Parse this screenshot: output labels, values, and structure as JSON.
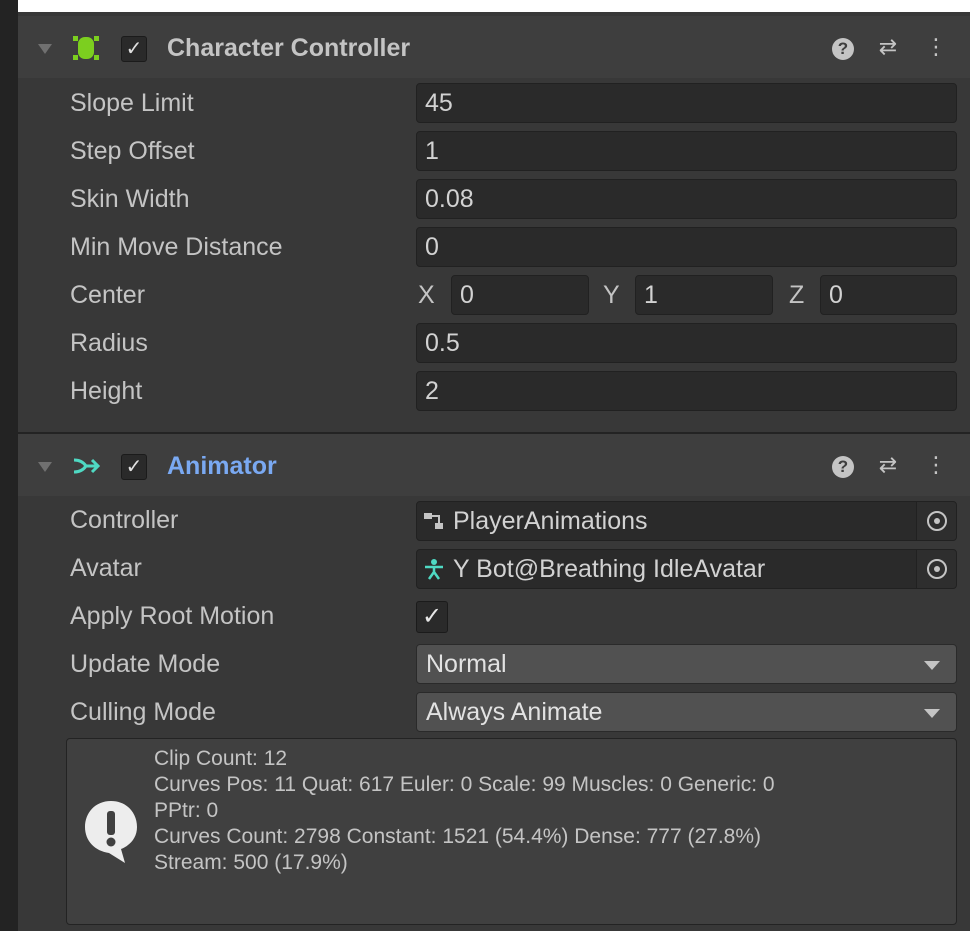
{
  "character_controller": {
    "title": "Character Controller",
    "enabled_mark": "✓",
    "fields": [
      {
        "label": "Slope Limit",
        "value": "45"
      },
      {
        "label": "Step Offset",
        "value": "1"
      },
      {
        "label": "Skin Width",
        "value": "0.08"
      },
      {
        "label": "Min Move Distance",
        "value": "0"
      }
    ],
    "center": {
      "label": "Center",
      "x_label": "X",
      "x": "0",
      "y_label": "Y",
      "y": "1",
      "z_label": "Z",
      "z": "0"
    },
    "fields2": [
      {
        "label": "Radius",
        "value": "0.5"
      },
      {
        "label": "Height",
        "value": "2"
      }
    ]
  },
  "animator": {
    "title": "Animator",
    "enabled_mark": "✓",
    "controller": {
      "label": "Controller",
      "value": "PlayerAnimations"
    },
    "avatar": {
      "label": "Avatar",
      "value": "Y Bot@Breathing IdleAvatar"
    },
    "apply_root_motion": {
      "label": "Apply Root Motion",
      "checked_mark": "✓"
    },
    "update_mode": {
      "label": "Update Mode",
      "value": "Normal"
    },
    "culling_mode": {
      "label": "Culling Mode",
      "value": "Always Animate"
    },
    "info_lines": [
      "Clip Count: 12",
      "Curves Pos: 11 Quat: 617 Euler: 0 Scale: 99 Muscles: 0 Generic: 0",
      "PPtr: 0",
      "Curves Count: 2798 Constant: 1521 (54.4%) Dense: 777 (27.8%)",
      "Stream: 500 (17.9%)"
    ]
  },
  "header_buttons": {
    "help": "?",
    "presets": "⇄",
    "more": "⋮"
  },
  "colors": {
    "panel_bg": "#383838",
    "header_bg": "#3e3e3e",
    "field_bg": "#2a2a2a",
    "dropdown_bg": "#515151",
    "cc_icon": "#7ccf1f",
    "animator_title": "#7aa9f2",
    "animator_icon": "#4fd9c3"
  }
}
